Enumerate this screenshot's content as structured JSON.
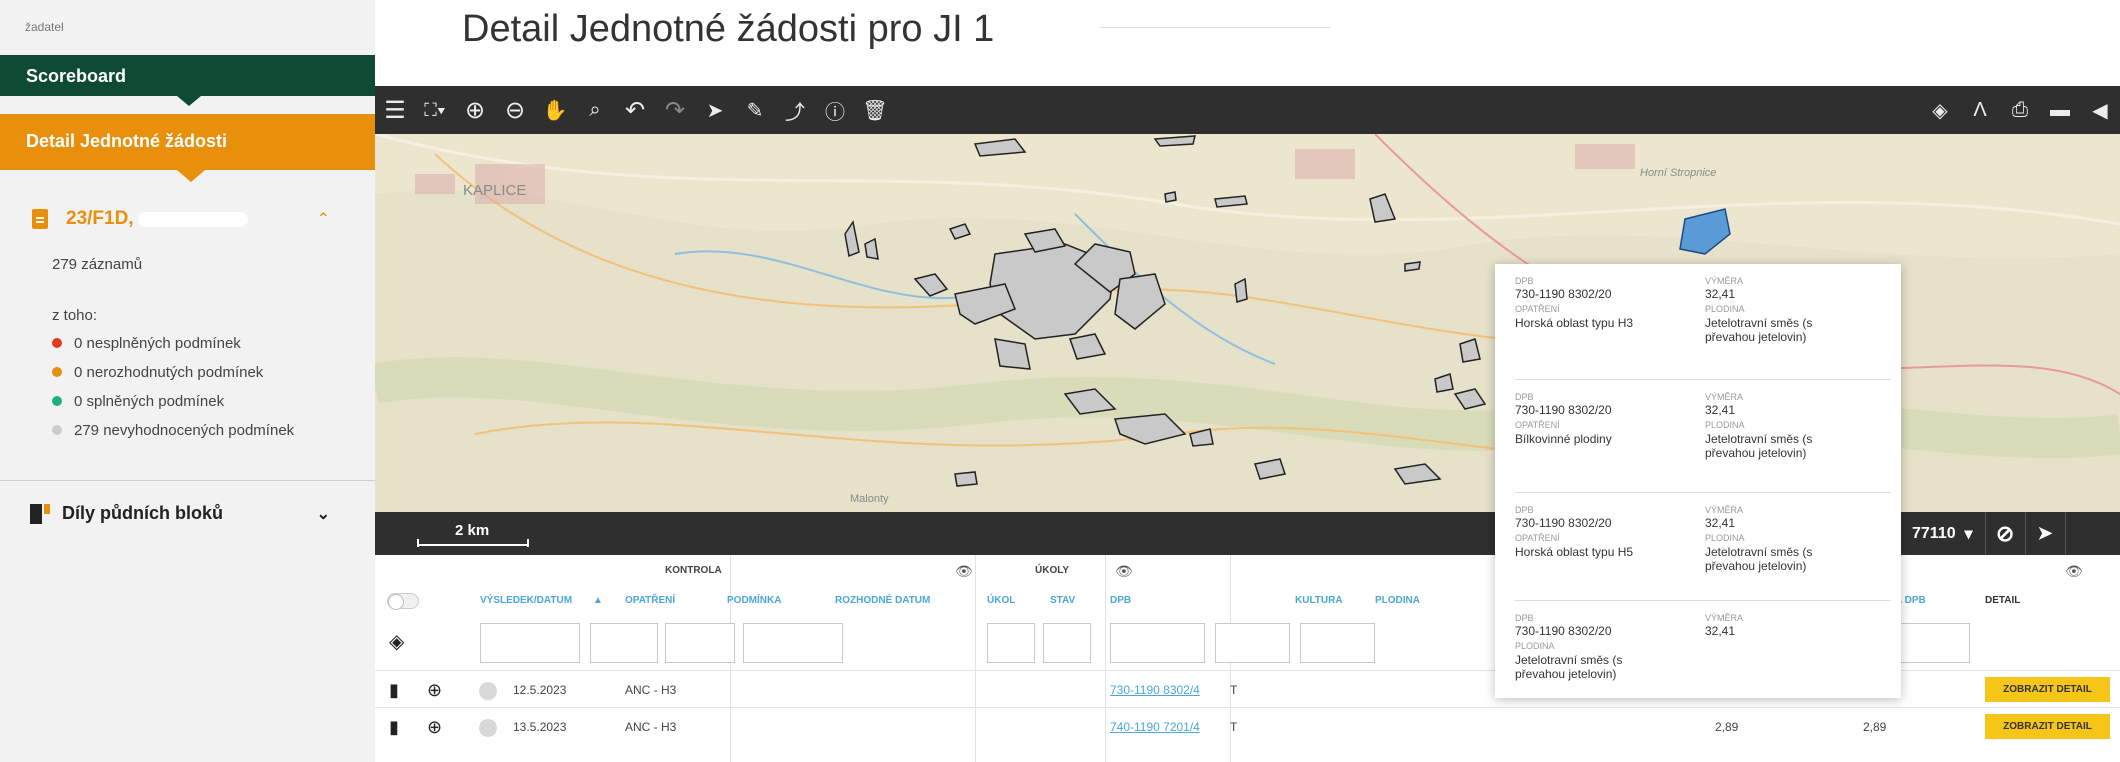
{
  "sidebar": {
    "top_label": "žadatel",
    "scoreboard": "Scoreboard",
    "detail": "Detail Jednotné žádosti",
    "case_title": "23/F1D,",
    "count": "279 záznamů",
    "of_which": "z toho:",
    "conditions": [
      {
        "label": "0 nesplněných podmínek",
        "color": "#e03c1e"
      },
      {
        "label": "0 nerozhodnutých podmínek",
        "color": "#e88f0c"
      },
      {
        "label": "0 splněných podmínek",
        "color": "#1fb17c"
      },
      {
        "label": "279 nevyhodnocených podmínek",
        "color": "#cccccc"
      }
    ],
    "blocks": "Díly půdních bloků"
  },
  "header": {
    "title": "Detail Jednotné žádosti pro JI 1"
  },
  "map": {
    "labels": {
      "kaplice": "KAPLICE",
      "horni_stropnice": "Horní Stropnice",
      "malonty": "Malonty"
    },
    "scale": "2 km",
    "selector_value": "77110"
  },
  "table": {
    "groups": {
      "kontrola": "KONTROLA",
      "ukoly": "ÚKOLY"
    },
    "columns": {
      "vysledek": "VÝSLEDEK/DATUM",
      "opatreni": "OPATŘENÍ",
      "podminka": "PODMÍNKA",
      "rozhodne": "ROZHODNÉ DATUM",
      "ukol": "ÚKOL",
      "stav": "STAV",
      "dpb": "DPB",
      "kultura": "KULTURA",
      "plodina": "PLODINA",
      "vymera_dpb": "A DPB",
      "detail": "DETAIL"
    },
    "rows": [
      {
        "date": "12.5.2023",
        "opatreni": "ANC - H3",
        "dpb": "730-1190 8302/4",
        "kultura": "T",
        "v1": "",
        "v2": "",
        "button": "ZOBRAZIT DETAIL"
      },
      {
        "date": "13.5.2023",
        "opatreni": "ANC - H3",
        "dpb": "740-1190 7201/4",
        "kultura": "T",
        "v1": "2,89",
        "v2": "2,89",
        "button": "ZOBRAZIT DETAIL"
      }
    ]
  },
  "popup": {
    "entries": [
      {
        "dpb_label": "DPB",
        "dpb": "730-1190 8302/20",
        "vym_label": "VÝMĚRA",
        "vym": "32,41",
        "op_label": "OPATŘENÍ",
        "op": "Horská oblast typu H3",
        "pl_label": "PLODINA",
        "pl": "Jetelotravní směs (s převahou jetelovin)"
      },
      {
        "dpb_label": "DPB",
        "dpb": "730-1190 8302/20",
        "vym_label": "VÝMĚRA",
        "vym": "32,41",
        "op_label": "OPATŘENÍ",
        "op": "Bílkovinné plodiny",
        "pl_label": "PLODINA",
        "pl": "Jetelotravní směs (s převahou jetelovin)"
      },
      {
        "dpb_label": "DPB",
        "dpb": "730-1190 8302/20",
        "vym_label": "VÝMĚRA",
        "vym": "32,41",
        "op_label": "OPATŘENÍ",
        "op": "Horská oblast typu H5",
        "pl_label": "PLODINA",
        "pl": "Jetelotravní směs (s převahou jetelovin)"
      },
      {
        "dpb_label": "DPB",
        "dpb": "730-1190 8302/20",
        "vym_label": "VÝMĚRA",
        "vym": "32,41",
        "pl_label": "PLODINA",
        "pl": "Jetelotravní směs (s převahou jetelovin)"
      }
    ]
  }
}
